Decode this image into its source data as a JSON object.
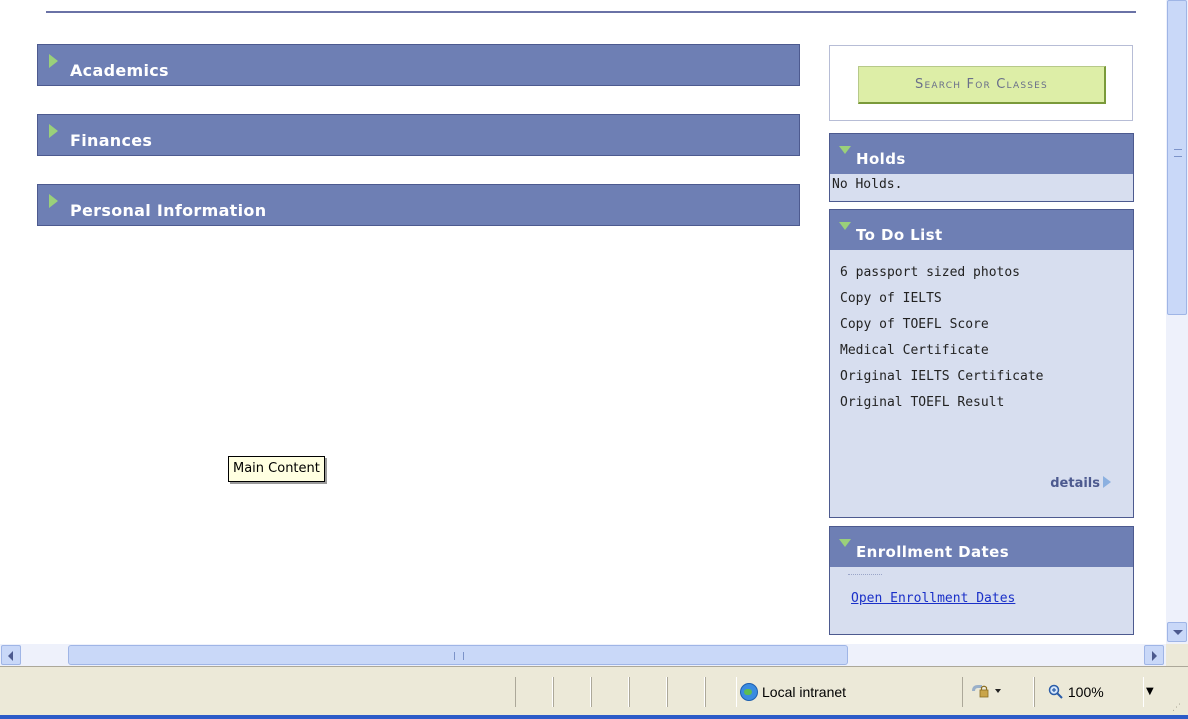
{
  "sections": [
    {
      "label": "Academics"
    },
    {
      "label": "Finances"
    },
    {
      "label": "Personal Information"
    }
  ],
  "search": {
    "button_label": "Search For Classes"
  },
  "holds": {
    "title": "Holds",
    "text": "No Holds."
  },
  "todo": {
    "title": "To Do List",
    "items": [
      "6 passport sized photos",
      "Copy of IELTS",
      "Copy of TOEFL Score",
      "Medical Certificate",
      "Original IELTS Certificate",
      "Original TOEFL Result"
    ],
    "details_label": "details"
  },
  "enrollment": {
    "title": "Enrollment Dates",
    "link_label": "Open Enrollment Dates"
  },
  "tooltip": {
    "text": "Main Content"
  },
  "statusbar": {
    "zone": "Local intranet",
    "zoom": "100%"
  },
  "colors": {
    "header": "#6e7fb4",
    "panel_bg": "#d7deef",
    "search_button": "#ddeea7",
    "expand_arrow": "#9ad07a",
    "link": "#1a30c8"
  },
  "icons": [
    "expand-arrow-icon",
    "collapse-arrow-icon",
    "details-arrow-icon",
    "globe-icon",
    "security-icon",
    "zoom-icon"
  ]
}
